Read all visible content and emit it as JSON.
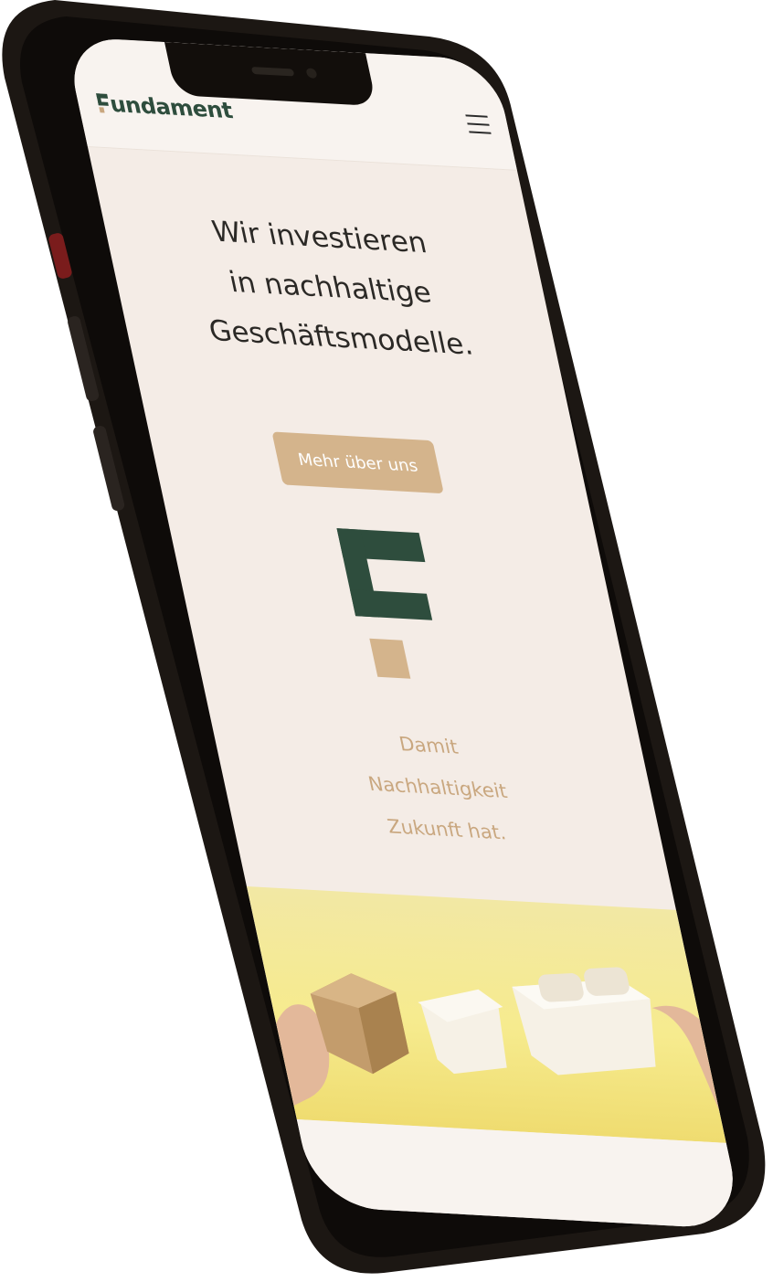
{
  "brand": {
    "name": "undament"
  },
  "menu": {
    "icon": "hamburger-menu-icon"
  },
  "hero": {
    "headline_lines": [
      "Wir investieren",
      "in nachhaltige",
      "Geschäftsmodelle."
    ],
    "cta_label": "Mehr über uns"
  },
  "tagline": {
    "lines": [
      "Damit",
      "Nachhaltigkeit",
      "Zukunft hat."
    ]
  },
  "colors": {
    "brand_green": "#2e4d3d",
    "brand_sand": "#d4b48c",
    "accent_text": "#c9a77f",
    "page_background": "#f4ece6",
    "phone_frame": "#1c1713"
  }
}
